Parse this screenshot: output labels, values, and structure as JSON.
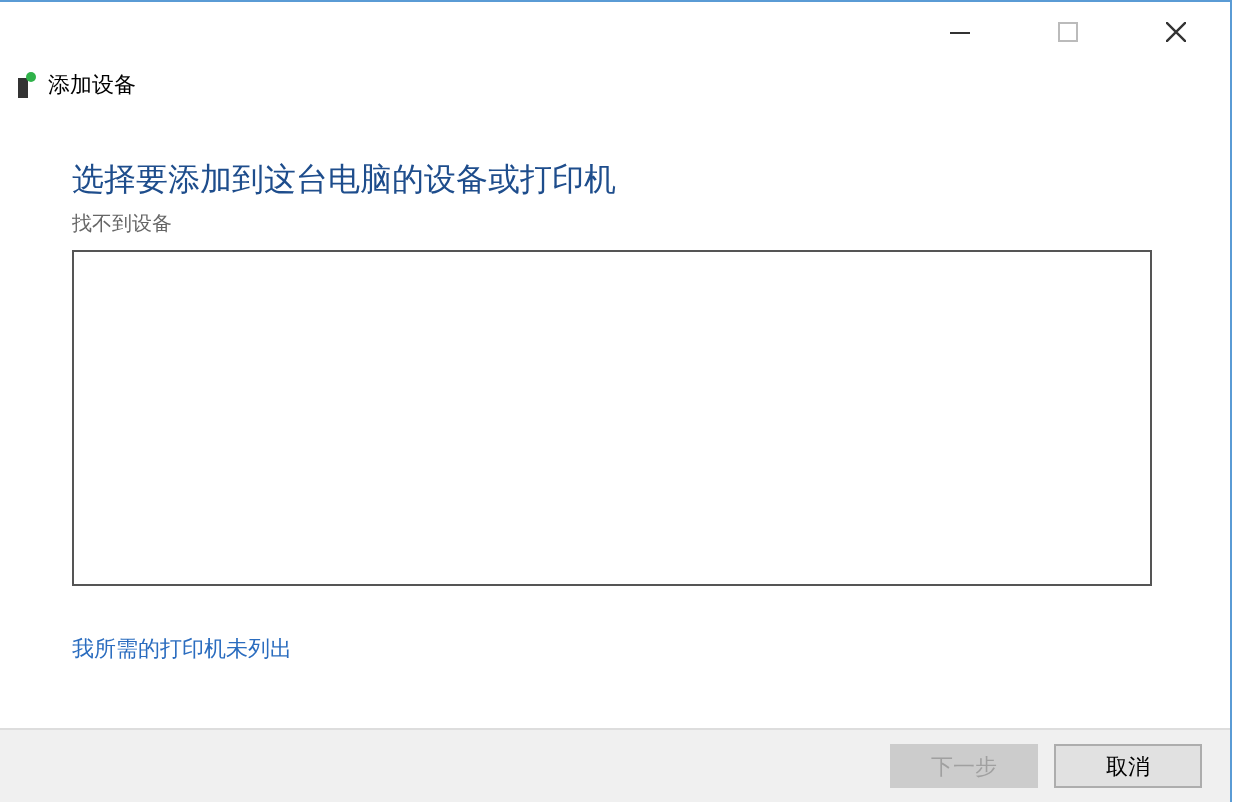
{
  "window": {
    "title": "添加设备"
  },
  "heading": "选择要添加到这台电脑的设备或打印机",
  "status": "找不到设备",
  "link": "我所需的打印机未列出",
  "buttons": [
    {
      "label": "下一步",
      "disabled": true
    },
    {
      "label": "取消",
      "disabled": false
    }
  ]
}
